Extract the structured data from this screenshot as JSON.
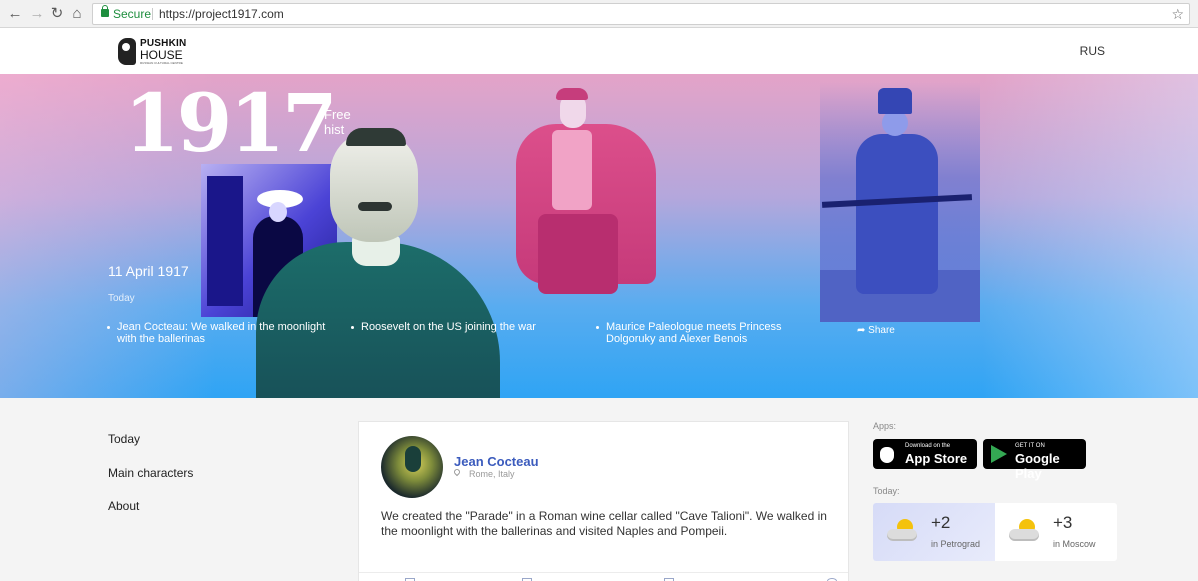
{
  "browser": {
    "secure_label": "Secure",
    "url": "https://project1917.com"
  },
  "header": {
    "logo_line1": "PUSHKIN",
    "logo_line2": "HOUSE",
    "logo_line3": "RUSSIAN CULTURAL CENTRE",
    "lang_label": "RUS"
  },
  "hero": {
    "year": "1917",
    "tagline_line1": "Free",
    "tagline_line2": "hist",
    "date": "11 April 1917",
    "today_label": "Today",
    "stories": [
      "Jean Cocteau: We walked in the moonlight with the ballerinas",
      "Roosevelt on the US joining the war",
      "Maurice Paleologue meets Princess Dolgoruky and Alexer Benois"
    ],
    "share_label": "Share"
  },
  "nav": {
    "items": [
      "Today",
      "Main characters",
      "About"
    ]
  },
  "post": {
    "author": "Jean Cocteau",
    "location": "Rome, Italy",
    "text": "We created the \"Parade\" in a Roman wine cellar called \"Cave Talioni\". We walked in the moonlight with the ballerinas and visited Naples and Pompeii."
  },
  "sidebar": {
    "apps_label": "Apps:",
    "appstore_small": "Download on the",
    "appstore_big": "App Store",
    "googleplay_small": "GET IT ON",
    "googleplay_big": "Google Play",
    "today_label": "Today:",
    "weather": [
      {
        "temp": "+2",
        "city": "in Petrograd"
      },
      {
        "temp": "+3",
        "city": "in Moscow"
      }
    ]
  },
  "colors": {
    "author_link": "#3b5bbd",
    "hero_top": "#e4a3c8",
    "hero_bottom": "#2fa4f4"
  }
}
